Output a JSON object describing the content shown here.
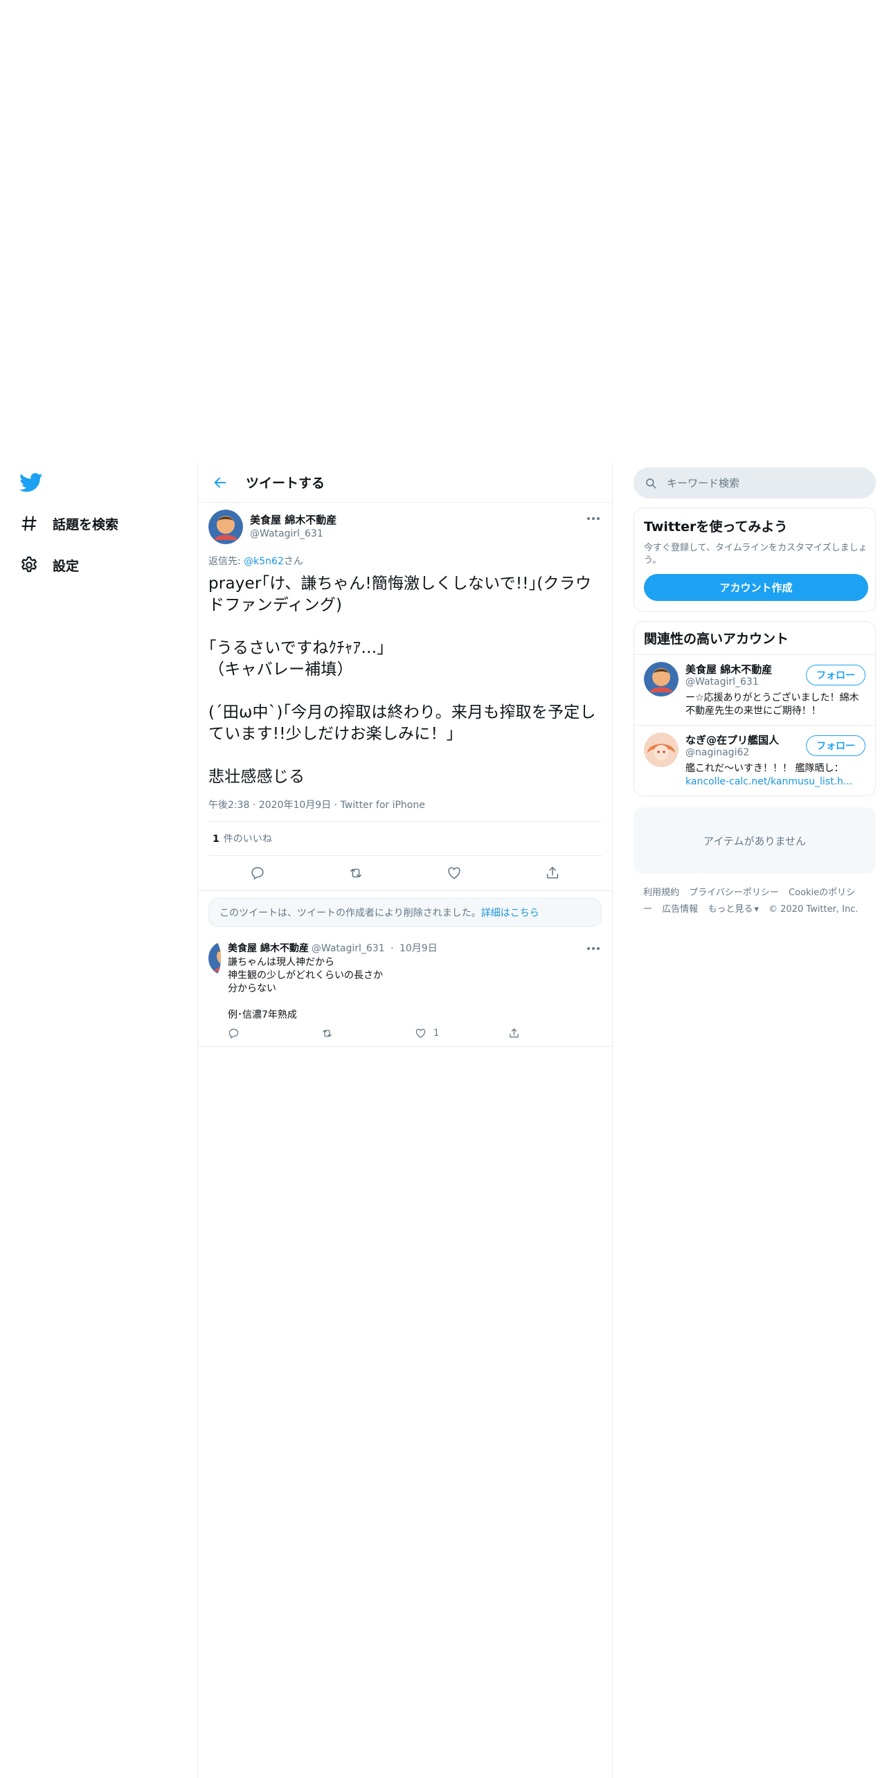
{
  "nav": {
    "explore_label": "話題を検索",
    "settings_label": "設定"
  },
  "header": {
    "title": "ツイートする"
  },
  "tweet": {
    "name": "美食屋 綿木不動産",
    "handle": "@Watagirl_631",
    "reply_prefix": "返信先: ",
    "reply_to": "@k5n62",
    "reply_suffix": "さん",
    "text": "prayer｢け、謙ちゃん!簡悔激しくしないで!!｣(クラウドファンディング)\n\n｢うるさいですねｸﾁｬｱ…｣\n（キャバレー補填）\n\n(´田ω中`)｢今月の搾取は終わり。来月も搾取を予定しています!!少しだけお楽しみに！｣\n\n悲壮感感じる",
    "time": "午後2:38",
    "date": "2020年10月9日",
    "client": "Twitter for iPhone",
    "like_count": "1",
    "like_label": "件のいいね"
  },
  "notice": {
    "text": "このツイートは、ツイートの作成者により削除されました。",
    "link": "詳細はこちら"
  },
  "reply": {
    "name": "美食屋 綿木不動産",
    "handle": "@Watagirl_631",
    "date": "10月9日",
    "text": "謙ちゃんは現人神だから\n神生観の少しがどれくらいの長さか\n分からない\n\n例･信濃7年熟成",
    "like_count": "1"
  },
  "search": {
    "placeholder": "キーワード検索"
  },
  "signup": {
    "title": "Twitterを使ってみよう",
    "desc": "今すぐ登録して、タイムラインをカスタマイズしましょう。",
    "button": "アカウント作成"
  },
  "related": {
    "title": "関連性の高いアカウント",
    "follow_label": "フォロー",
    "accounts": [
      {
        "name": "美食屋 綿木不動産",
        "handle": "@Watagirl_631",
        "bio": "ー☆応援ありがとうございました！綿木不動産先生の来世にご期待！！"
      },
      {
        "name": "なぎ@在プリ艦国人",
        "handle": "@naginagi62",
        "bio": "艦これだ～いすき！！！ 艦隊晒し：",
        "link": "kancolle-calc.net/kanmusu_list.h..."
      }
    ]
  },
  "empty_text": "アイテムがありません",
  "footer": {
    "links": [
      "利用規約",
      "プライバシーポリシー",
      "Cookieのポリシー",
      "広告情報",
      "もっと見る"
    ],
    "copyright": "© 2020 Twitter, Inc."
  },
  "colors": {
    "accent": "#1da1f2",
    "link": "#1b95e0",
    "muted": "#657786",
    "border": "#e6ecf0"
  }
}
